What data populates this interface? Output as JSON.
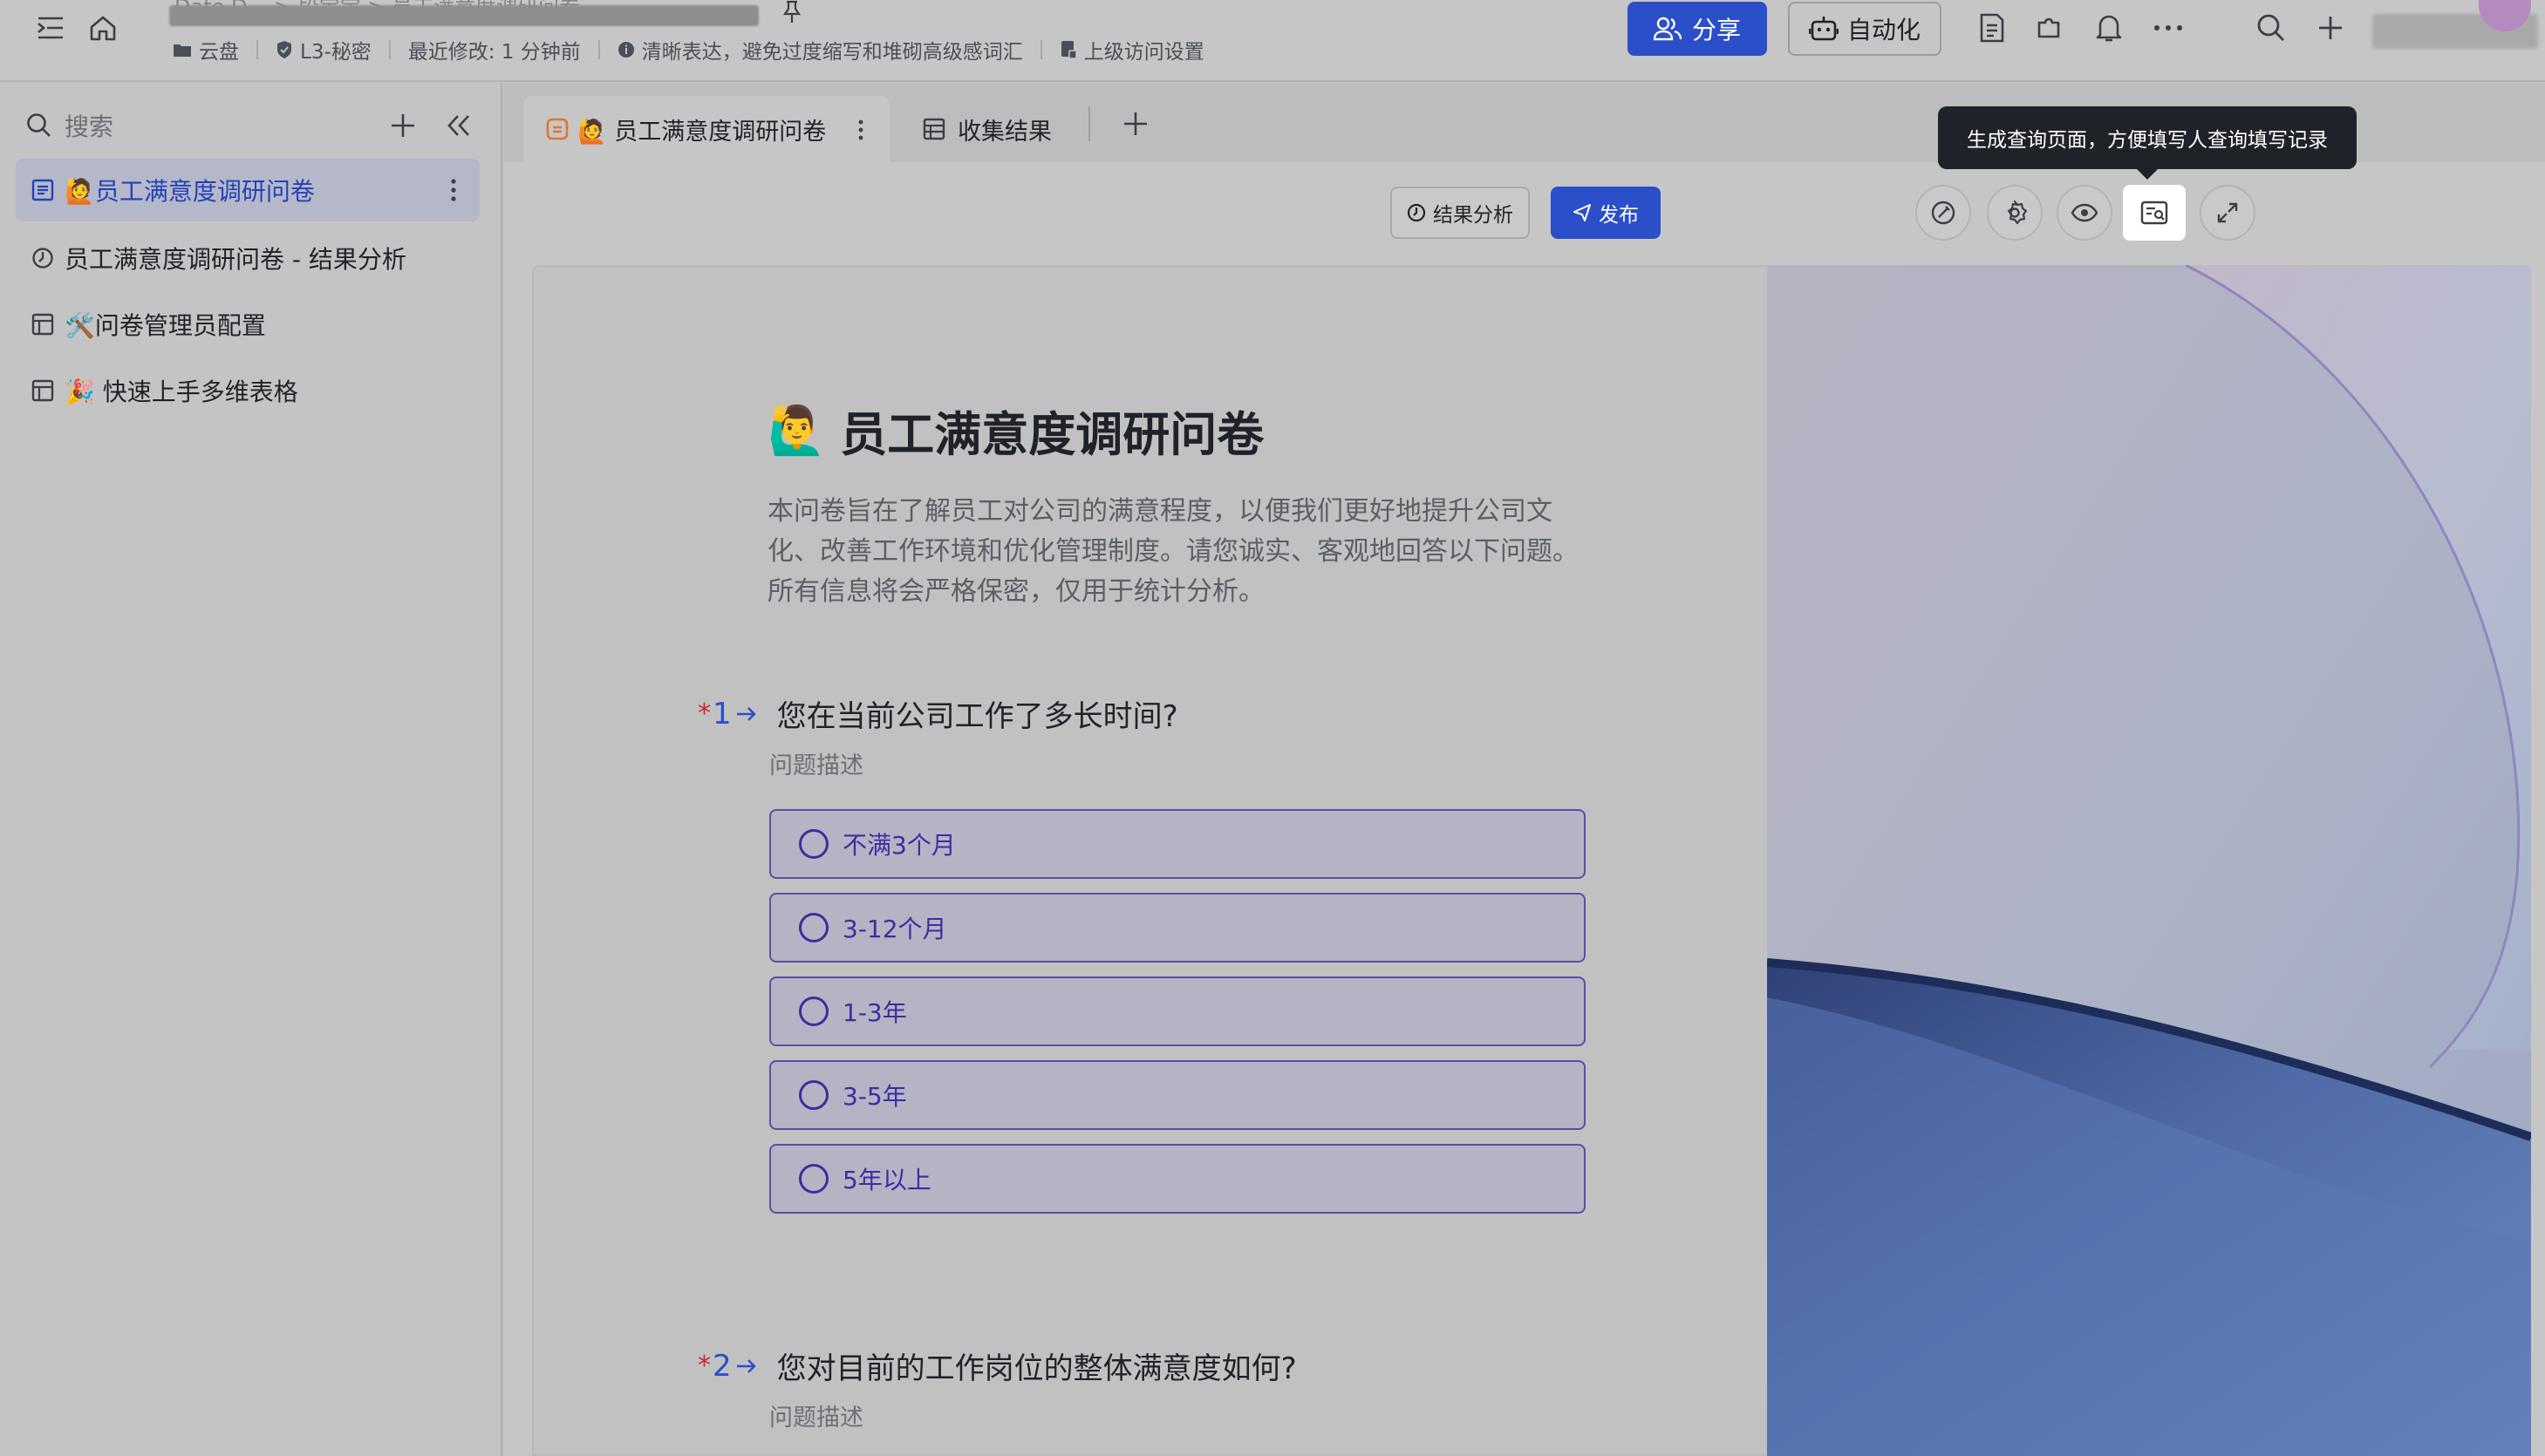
{
  "topbar": {
    "breadcrumb_faint": "Date D... > 段宝宝 > 员工满意度调研问卷",
    "meta": {
      "location": "云盘",
      "security": "L3-秘密",
      "last_modified": "最近修改: 1 分钟前",
      "notice": "清晰表达，避免过度缩写和堆砌高级感词汇",
      "access": "上级访问设置"
    },
    "share_label": "分享",
    "automation_label": "自动化",
    "accent": "#2a4fc8"
  },
  "sidebar": {
    "search_placeholder": "搜索",
    "items": [
      {
        "emoji": "🙋",
        "label": "员工满意度调研问卷",
        "icon": "form-icon",
        "active": true
      },
      {
        "emoji": "",
        "label": "员工满意度调研问卷 - 结果分析",
        "icon": "dashboard-icon",
        "active": false
      },
      {
        "emoji": "🛠️",
        "label": "问卷管理员配置",
        "icon": "table-icon",
        "active": false
      },
      {
        "emoji": "🎉",
        "label": "快速上手多维表格",
        "icon": "table-icon",
        "active": false
      }
    ]
  },
  "tabs": {
    "active": {
      "emoji": "🙋",
      "label": "员工满意度调研问卷",
      "icon": "form-icon"
    },
    "results": {
      "label": "收集结果",
      "icon": "table-icon"
    }
  },
  "toolbar": {
    "tooltip": "生成查询页面，方便填写人查询填写记录",
    "result_analysis_label": "结果分析",
    "publish_label": "发布"
  },
  "form": {
    "emoji": "🙋‍♂️",
    "title": "员工满意度调研问卷",
    "description": "本问卷旨在了解员工对公司的满意程度，以便我们更好地提升公司文化、改善工作环境和优化管理制度。请您诚实、客观地回答以下问题。所有信息将会严格保密，仅用于统计分析。",
    "questions": [
      {
        "required_mark": "*",
        "number": "1",
        "title": "您在当前公司工作了多长时间?",
        "subtitle": "问题描述",
        "options": [
          "不满3个月",
          "3-12个月",
          "1-3年",
          "3-5年",
          "5年以上"
        ]
      },
      {
        "required_mark": "*",
        "number": "2",
        "title": "您对目前的工作岗位的整体满意度如何?",
        "subtitle": "问题描述",
        "options": []
      }
    ]
  }
}
